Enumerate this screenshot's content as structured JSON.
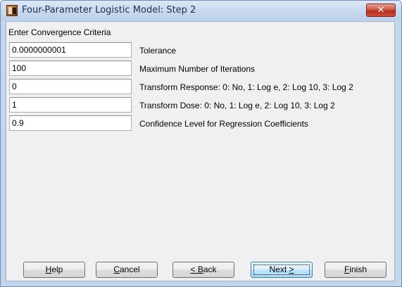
{
  "window": {
    "title": "Four-Parameter Logistic Model: Step 2",
    "close_label": "✕",
    "icon": "app-logo-icon"
  },
  "section": {
    "label": "Enter Convergence Criteria"
  },
  "fields": [
    {
      "value": "0.0000000001",
      "label": "Tolerance"
    },
    {
      "value": "100",
      "label": "Maximum Number of Iterations"
    },
    {
      "value": "0",
      "label": "Transform Response: 0: No, 1: Log e, 2: Log 10, 3: Log 2"
    },
    {
      "value": "1",
      "label": "Transform Dose: 0: No, 1: Log e, 2: Log 10, 3: Log 2"
    },
    {
      "value": "0.9",
      "label": "Confidence Level for Regression Coefficients"
    }
  ],
  "buttons": {
    "help": {
      "mnemonic": "H",
      "rest": "elp"
    },
    "cancel": {
      "mnemonic": "C",
      "rest": "ancel"
    },
    "back": {
      "prefix": "< ",
      "mnemonic": "B",
      "rest": "ack"
    },
    "next": {
      "prefix": "Next ",
      "mnemonic": ">",
      "rest": ""
    },
    "finish": {
      "mnemonic": "F",
      "rest": "inish"
    }
  },
  "colors": {
    "title_bar": "#c7d9ef",
    "close_button": "#c7412f",
    "dialog_face": "#f0f0f0",
    "default_button_border": "#3c7fb1"
  }
}
